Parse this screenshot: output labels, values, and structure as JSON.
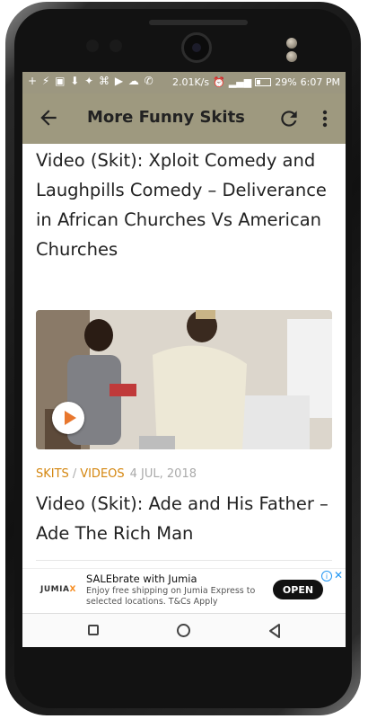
{
  "status_bar": {
    "left_icons": "+ ⚡ ▣ ⬇ ✦ ⌘ ▶ ☁ ✆",
    "net_speed": "2.01K/s",
    "battery": "29%",
    "time": "6:07 PM"
  },
  "app_bar": {
    "title": "More Funny Skits",
    "back_icon": "arrow-left-icon",
    "refresh_icon": "refresh-icon",
    "overflow_icon": "more-vert-icon"
  },
  "posts": [
    {
      "title": "Video (Skit): Xploit Comedy and Laughpills Comedy – Deliverance in African Churches Vs American Churches"
    },
    {
      "title": "Video (Skit): Ade and His Father – Ade The Rich Man",
      "categories": [
        "SKITS",
        "VIDEOS"
      ],
      "category_separator": "/",
      "date": "4 JUL, 2018",
      "thumbnail_overlay": "play-icon"
    }
  ],
  "ad": {
    "logo_text": "JUMIA",
    "logo_accent": "X",
    "title": "SALEbrate with Jumia",
    "description": "Enjoy free shipping on Jumia Express to selected locations. T&Cs Apply",
    "cta": "OPEN",
    "close": "✕"
  },
  "colors": {
    "app_bar": "#9e997f",
    "category": "#d4860f",
    "play": "#e8772e"
  }
}
